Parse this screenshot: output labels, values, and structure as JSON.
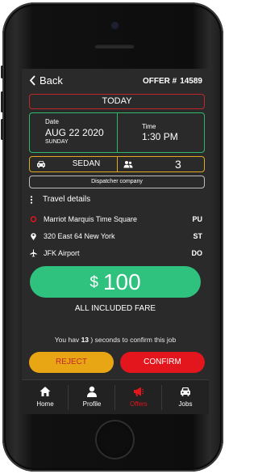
{
  "header": {
    "back_label": "Back",
    "offer_label": "OFFER #",
    "offer_number": "14589"
  },
  "day_banner": "TODAY",
  "schedule": {
    "date_label": "Date",
    "date_value": "AUG 22 2020",
    "day_value": "SUNDAY",
    "time_label": "Time",
    "time_value": "1:30 PM"
  },
  "vehicle": {
    "type": "SEDAN",
    "passengers": "3"
  },
  "dispatcher_label": "Dispatcher company",
  "travel": {
    "title": "Travel details",
    "stops": [
      {
        "address": "Marriot Marquis Time Square",
        "code": "PU",
        "icon": "pickup-circle-icon"
      },
      {
        "address": "320 East 64 New York",
        "code": "ST",
        "icon": "location-pin-icon"
      },
      {
        "address": "JFK Airport",
        "code": "DO",
        "icon": "airplane-icon"
      }
    ]
  },
  "fare": {
    "currency": "$",
    "amount": "100",
    "note": "ALL INCLUDED FARE"
  },
  "timer": {
    "prefix": "You hav",
    "seconds": "13",
    "suffix": ") seconds to confirm this job"
  },
  "actions": {
    "reject_label": "REJECT",
    "confirm_label": "CONFIRM"
  },
  "tabs": [
    {
      "label": "Home",
      "icon": "home-icon"
    },
    {
      "label": "Profile",
      "icon": "person-icon"
    },
    {
      "label": "Offers",
      "icon": "megaphone-icon",
      "active": true
    },
    {
      "label": "Jobs",
      "icon": "car-icon"
    }
  ],
  "colors": {
    "accent_green": "#2ec27e",
    "accent_red": "#e2161c",
    "accent_yellow": "#e8a615",
    "screen_bg": "#2a2a2a"
  }
}
